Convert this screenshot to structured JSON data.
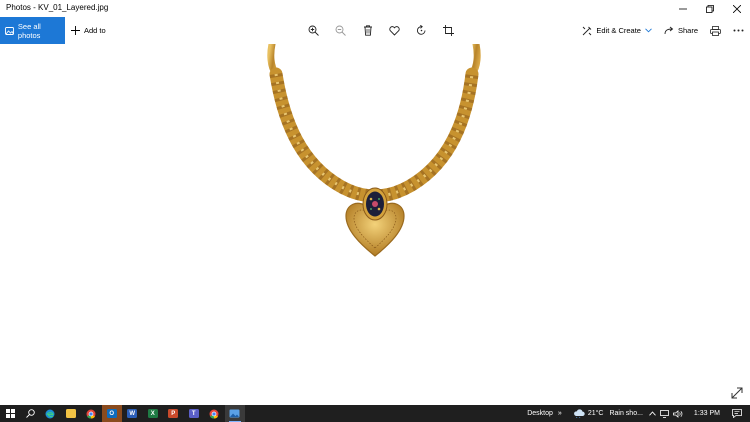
{
  "window": {
    "title": "Photos - KV_01_Layered.jpg"
  },
  "toolbar": {
    "see_all_label": "See all photos",
    "add_to_label": "Add to",
    "edit_create_label": "Edit & Create",
    "share_label": "Share"
  },
  "tool_icons": [
    "zoom-in-icon",
    "zoom-out-icon",
    "delete-icon",
    "favorite-heart-icon",
    "rotate-icon",
    "crop-icon"
  ],
  "taskbar": {
    "apps": [
      "file-explorer",
      "chrome",
      "outlook",
      "word",
      "excel",
      "powerpoint",
      "teams",
      "chrome",
      "photos"
    ],
    "desktop_label": "Desktop",
    "chevron": "»",
    "weather_temp": "21°C",
    "weather_text": "Rain sho...",
    "time": "1:33 PM"
  },
  "colors": {
    "accent": "#1d78d6",
    "taskbar_bg": "#1f1f1f",
    "gold": "#c9952e"
  }
}
